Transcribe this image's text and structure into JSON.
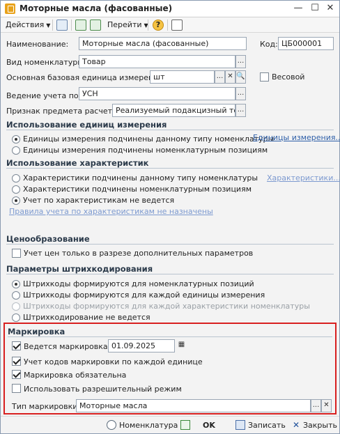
{
  "window": {
    "title": "Моторные масла (фасованные)",
    "controls": {
      "minimize": "—",
      "maximize": "☐",
      "close": "✕"
    }
  },
  "toolbar": {
    "actions_label": "Действия",
    "goto_label": "Перейти",
    "help_label": "?"
  },
  "form": {
    "name_label": "Наименование:",
    "name_value": "Моторные масла (фасованные)",
    "code_label": "Код:",
    "code_value": "ЦБ000001",
    "kind_label": "Вид номенклатуры:",
    "kind_value": "Товар",
    "unit_label": "Основная базовая единица измерения:",
    "unit_value": "шт",
    "weight_label": "Весовой",
    "accounting_label": "Ведение учета по:",
    "accounting_value": "УСН",
    "calc_label": "Признак предмета расчета:",
    "calc_value": "Реализуемый подакцизный товар",
    "ellipsis": "..."
  },
  "units_section": {
    "title": "Использование единиц измерения",
    "options": [
      {
        "label": "Единицы измерения подчинены данному типу номенклатуры",
        "selected": true
      },
      {
        "label": "Единицы измерения подчинены номенклатурным позициям",
        "selected": false
      }
    ],
    "link": "Единицы измерения..."
  },
  "chars_section": {
    "title": "Использование характеристик",
    "options": [
      {
        "label": "Характеристики подчинены данному типу номенклатуры",
        "selected": false
      },
      {
        "label": "Характеристики подчинены номенклатурным позициям",
        "selected": false
      },
      {
        "label": "Учет по характеристикам не ведется",
        "selected": true
      }
    ],
    "link": "Характеристики...",
    "rules_link": "Правила учета по характеристикам не назначены"
  },
  "pricing_section": {
    "title": "Ценообразование",
    "checkbox_label": "Учет цен только в разрезе дополнительных параметров",
    "checked": false
  },
  "barcode_section": {
    "title": "Параметры штрихкодирования",
    "options": [
      {
        "label": "Штрихкоды формируются для номенклатурных позиций",
        "selected": true,
        "disabled": false
      },
      {
        "label": "Штрихкоды формируются для каждой единицы измерения",
        "selected": false,
        "disabled": false
      },
      {
        "label": "Штрихкоды формируются для каждой характеристики номенклатуры",
        "selected": false,
        "disabled": true
      },
      {
        "label": "Штрихкодирование не ведется",
        "selected": false,
        "disabled": false
      }
    ]
  },
  "marking_section": {
    "title": "Маркировка",
    "marking_from_label": "Ведется маркировка с",
    "marking_from_date": "01.09.2025",
    "per_unit_label": "Учет кодов маркировки по каждой единице",
    "mandatory_label": "Маркировка обязательна",
    "permit_label": "Использовать разрешительный режим",
    "type_label": "Тип маркировки:",
    "type_value": "Моторные масла",
    "checks": {
      "marking_from": true,
      "per_unit": true,
      "mandatory": true,
      "permit": false
    }
  },
  "footer": {
    "nomenclature_label": "Номенклатура",
    "ok_label": "OK",
    "save_label": "Записать",
    "close_label": "Закрыть"
  },
  "colors": {
    "highlight_border": "#d81f1f",
    "link": "#2e5fa8",
    "section_text": "#2b3a4a"
  }
}
